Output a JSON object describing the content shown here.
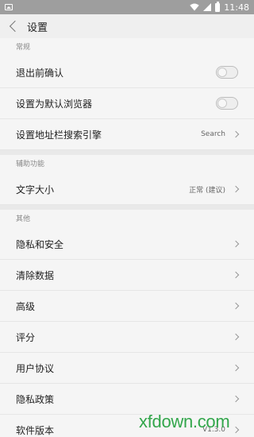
{
  "status_bar": {
    "time": "11:48",
    "icons": [
      "gallery-icon",
      "wifi-icon",
      "signal-icon",
      "battery-icon"
    ]
  },
  "header": {
    "back_icon": "chevron-left-icon",
    "title": "设置"
  },
  "sections": [
    {
      "label": "常规",
      "items": [
        {
          "label": "退出前确认",
          "control": "toggle",
          "on": false
        },
        {
          "label": "设置为默认浏览器",
          "control": "toggle",
          "on": false
        },
        {
          "label": "设置地址栏搜索引擎",
          "value": "Search",
          "control": "chevron"
        }
      ]
    },
    {
      "label": "辅助功能",
      "items": [
        {
          "label": "文字大小",
          "value": "正常 (建议)",
          "control": "chevron"
        }
      ]
    },
    {
      "label": "其他",
      "items": [
        {
          "label": "隐私和安全",
          "control": "chevron"
        },
        {
          "label": "清除数据",
          "control": "chevron"
        },
        {
          "label": "高级",
          "control": "chevron"
        },
        {
          "label": "评分",
          "control": "chevron"
        },
        {
          "label": "用户协议",
          "control": "chevron"
        },
        {
          "label": "隐私政策",
          "control": "chevron"
        },
        {
          "label": "软件版本",
          "value": "V1.3.0",
          "control": "chevron"
        }
      ]
    }
  ],
  "watermark": "xfdown.com",
  "colors": {
    "status_bar": "#9e9e9e",
    "background": "#f5f5f5",
    "watermark": "#32a64b"
  }
}
